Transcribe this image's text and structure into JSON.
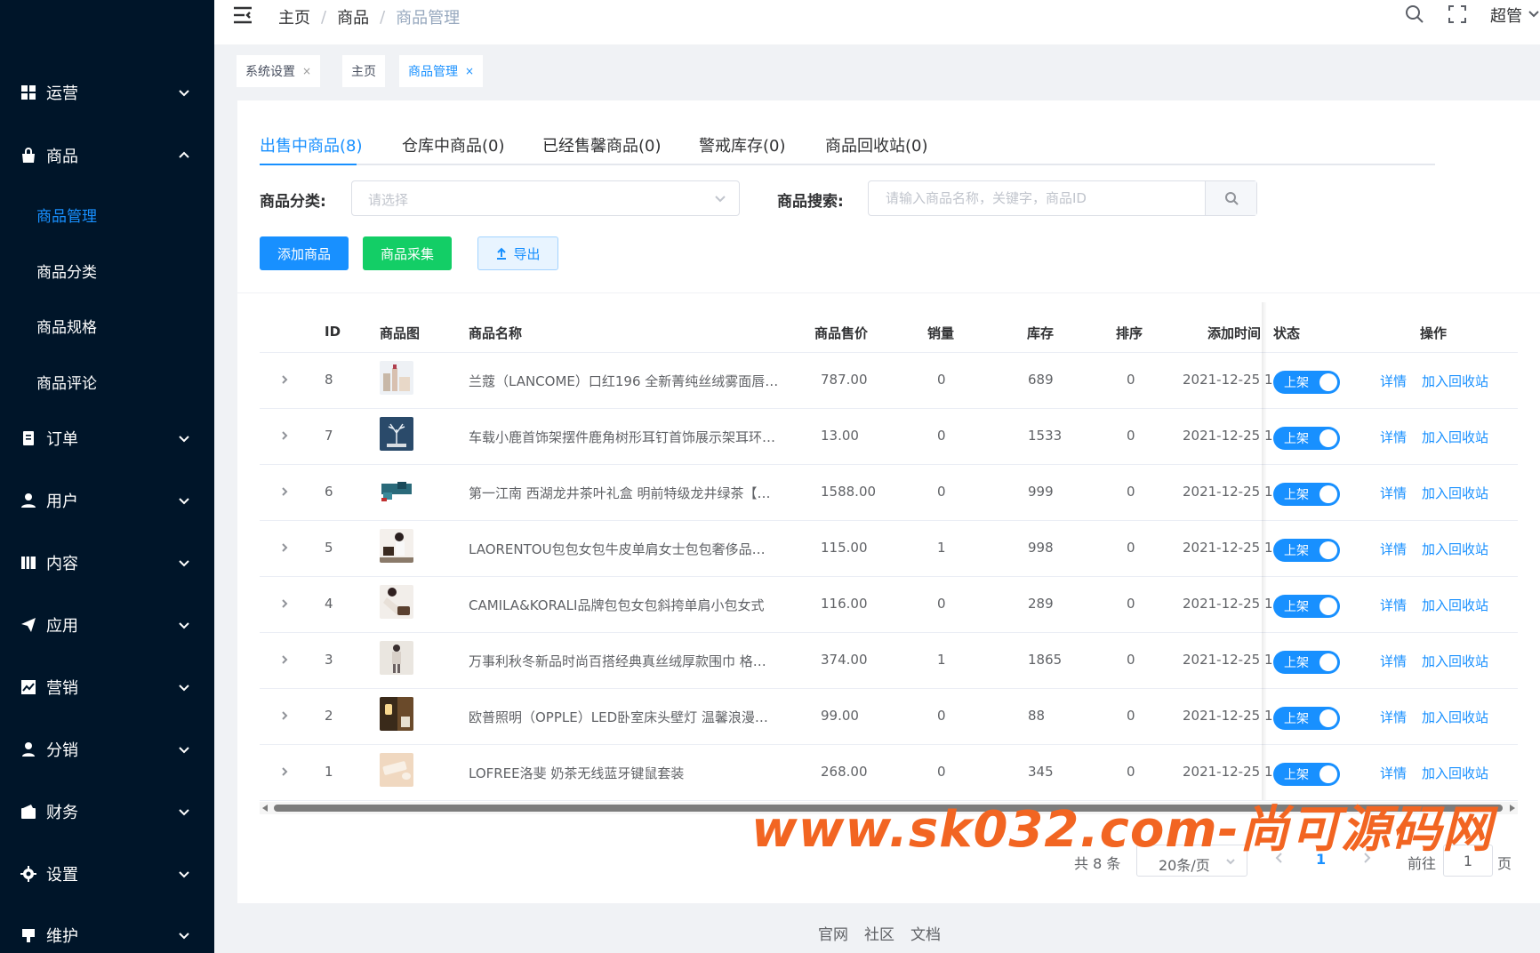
{
  "sidebar": {
    "menus": [
      {
        "label": "运营",
        "icon": "grid-icon",
        "expanded": false
      },
      {
        "label": "商品",
        "icon": "bag-icon",
        "expanded": true
      },
      {
        "label": "订单",
        "icon": "order-icon",
        "expanded": false
      },
      {
        "label": "用户",
        "icon": "user-icon",
        "expanded": false
      },
      {
        "label": "内容",
        "icon": "content-icon",
        "expanded": false
      },
      {
        "label": "应用",
        "icon": "send-icon",
        "expanded": false
      },
      {
        "label": "营销",
        "icon": "chart-icon",
        "expanded": false
      },
      {
        "label": "分销",
        "icon": "person-icon",
        "expanded": false
      },
      {
        "label": "财务",
        "icon": "wallet-icon",
        "expanded": false
      },
      {
        "label": "设置",
        "icon": "gear-icon",
        "expanded": false
      },
      {
        "label": "维护",
        "icon": "flag-icon",
        "expanded": false
      }
    ],
    "submenu": [
      {
        "label": "商品管理",
        "active": true
      },
      {
        "label": "商品分类",
        "active": false
      },
      {
        "label": "商品规格",
        "active": false
      },
      {
        "label": "商品评论",
        "active": false
      }
    ]
  },
  "header": {
    "breadcrumb": [
      "主页",
      "商品",
      "商品管理"
    ],
    "user": "超管"
  },
  "tags": [
    {
      "label": "系统设置",
      "closable": true,
      "active": false
    },
    {
      "label": "主页",
      "closable": false,
      "active": false
    },
    {
      "label": "商品管理",
      "closable": true,
      "active": true
    }
  ],
  "tabs": [
    "出售中商品(8)",
    "仓库中商品(0)",
    "已经售馨商品(0)",
    "警戒库存(0)",
    "商品回收站(0)"
  ],
  "filters": {
    "category_label": "商品分类:",
    "category_placeholder": "请选择",
    "search_label": "商品搜索:",
    "search_placeholder": "请输入商品名称，关键字，商品ID"
  },
  "actions": {
    "add": "添加商品",
    "collect": "商品采集",
    "export": "导出"
  },
  "table": {
    "columns": [
      "ID",
      "商品图",
      "商品名称",
      "商品售价",
      "销量",
      "库存",
      "排序",
      "添加时间",
      "状态",
      "操作"
    ],
    "rows": [
      {
        "id": "8",
        "name": "兰蔻（LANCOME）口红196 全新菁纯丝绒雾面唇…",
        "price": "787.00",
        "sales": "0",
        "stock": "689",
        "sort": "0",
        "time": "2021-12-25 1",
        "status": "上架",
        "detail": "详情",
        "recycle": "加入回收站"
      },
      {
        "id": "7",
        "name": "车载小鹿首饰架摆件鹿角树形耳钉首饰展示架耳环…",
        "price": "13.00",
        "sales": "0",
        "stock": "1533",
        "sort": "0",
        "time": "2021-12-25 1",
        "status": "上架",
        "detail": "详情",
        "recycle": "加入回收站"
      },
      {
        "id": "6",
        "name": "第一江南 西湖龙井茶叶礼盒 明前特级龙井绿茶【…",
        "price": "1588.00",
        "sales": "0",
        "stock": "999",
        "sort": "0",
        "time": "2021-12-25 1",
        "status": "上架",
        "detail": "详情",
        "recycle": "加入回收站"
      },
      {
        "id": "5",
        "name": "LAORENTOU包包女包牛皮单肩女士包包奢侈品…",
        "price": "115.00",
        "sales": "1",
        "stock": "998",
        "sort": "0",
        "time": "2021-12-25 1",
        "status": "上架",
        "detail": "详情",
        "recycle": "加入回收站"
      },
      {
        "id": "4",
        "name": "CAMILA&KORALI品牌包包女包斜挎单肩小包女式",
        "price": "116.00",
        "sales": "0",
        "stock": "289",
        "sort": "0",
        "time": "2021-12-25 1",
        "status": "上架",
        "detail": "详情",
        "recycle": "加入回收站"
      },
      {
        "id": "3",
        "name": "万事利秋冬新品时尚百搭经典真丝绒厚款围巾 格…",
        "price": "374.00",
        "sales": "1",
        "stock": "1865",
        "sort": "0",
        "time": "2021-12-25 1",
        "status": "上架",
        "detail": "详情",
        "recycle": "加入回收站"
      },
      {
        "id": "2",
        "name": "欧普照明（OPPLE）LED卧室床头壁灯 温馨浪漫…",
        "price": "99.00",
        "sales": "0",
        "stock": "88",
        "sort": "0",
        "time": "2021-12-25 1",
        "status": "上架",
        "detail": "详情",
        "recycle": "加入回收站"
      },
      {
        "id": "1",
        "name": "LOFREE洛斐 奶茶无线蓝牙键鼠套装",
        "price": "268.00",
        "sales": "0",
        "stock": "345",
        "sort": "0",
        "time": "2021-12-25 1",
        "status": "上架",
        "detail": "详情",
        "recycle": "加入回收站"
      }
    ]
  },
  "pagination": {
    "total": "共 8 条",
    "page_size": "20条/页",
    "current": "1",
    "goto_label": "前往",
    "goto_value": "1",
    "page_suffix": "页"
  },
  "footer": [
    "官网",
    "社区",
    "文档"
  ],
  "watermark": "www.sk032.com-尚可源码网",
  "colors": {
    "primary": "#1890ff",
    "success": "#13ce66",
    "sidebar": "#001529",
    "watermark": "#f26522"
  }
}
